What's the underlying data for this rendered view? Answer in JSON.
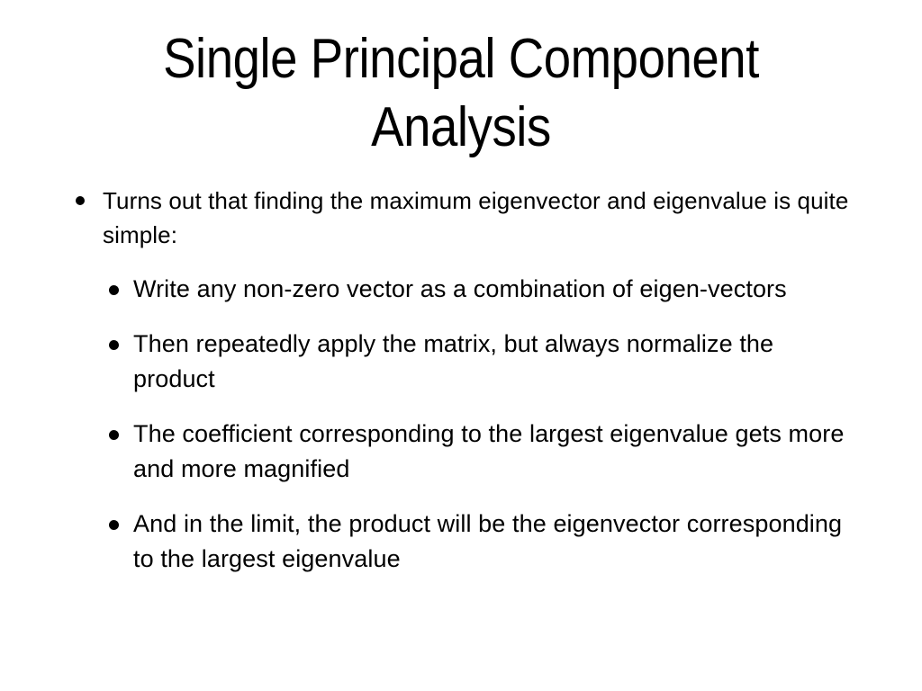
{
  "slide": {
    "background_color": "#ffffff",
    "text_color": "#000000",
    "title": {
      "line1": "Single Principal Component",
      "line2": "Analysis",
      "full": "Single Principal Component Analysis"
    },
    "bullets": [
      {
        "level": 1,
        "marker": "round-bullet",
        "text": "Turns out that finding the maximum eigenvector and eigenvalue is quite simple:"
      }
    ],
    "sub_bullets": [
      {
        "level": 2,
        "marker": "round-bullet",
        "text": "Write any non-zero vector as a combination of eigen-vectors"
      },
      {
        "level": 2,
        "marker": "round-bullet",
        "text": "Then repeatedly apply the matrix, but always normalize the product"
      },
      {
        "level": 2,
        "marker": "round-bullet",
        "text": "The coefficient corresponding to the largest eigenvalue gets more and more magnified"
      },
      {
        "level": 2,
        "marker": "round-bullet",
        "text": "And in the limit, the product will be the eigenvector corresponding to the largest eigenvalue"
      }
    ]
  }
}
